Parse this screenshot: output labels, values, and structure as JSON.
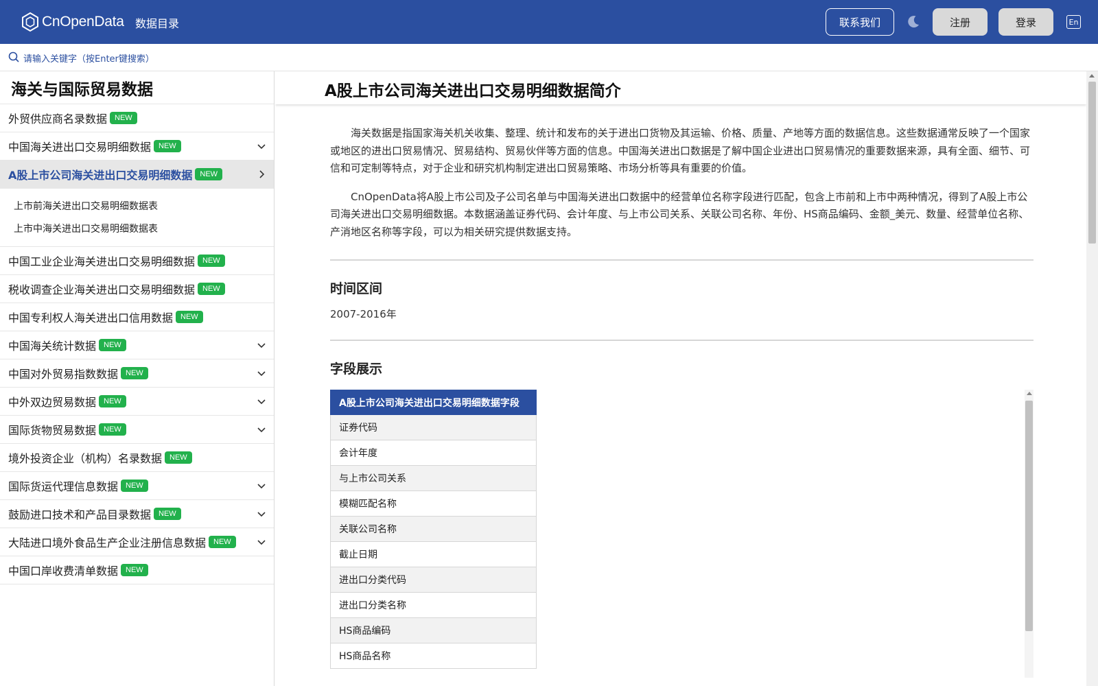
{
  "header": {
    "logo_text": "CnOpenData",
    "nav_catalog": "数据目录",
    "contact": "联系我们",
    "theme_icon": "moon-icon",
    "register": "注册",
    "login": "登录",
    "lang": "En",
    "brand_color": "#2b4fa0"
  },
  "search": {
    "placeholder": "请输入关键字（按Enter键搜索）"
  },
  "sidebar": {
    "title": "海关与国际贸易数据",
    "badge": "NEW",
    "badge_color": "#22b14c",
    "items": [
      {
        "label": "外贸供应商名录数据",
        "expandable": false
      },
      {
        "label": "中国海关进出口交易明细数据",
        "expandable": true
      },
      {
        "label": "A股上市公司海关进出口交易明细数据",
        "expandable": true,
        "active": true
      },
      {
        "label": "中国工业企业海关进出口交易明细数据",
        "expandable": false
      },
      {
        "label": "税收调查企业海关进出口交易明细数据",
        "expandable": false
      },
      {
        "label": "中国专利权人海关进出口信用数据",
        "expandable": false
      },
      {
        "label": "中国海关统计数据",
        "expandable": true
      },
      {
        "label": "中国对外贸易指数数据",
        "expandable": true
      },
      {
        "label": "中外双边贸易数据",
        "expandable": true
      },
      {
        "label": "国际货物贸易数据",
        "expandable": true
      },
      {
        "label": "境外投资企业（机构）名录数据",
        "expandable": false
      },
      {
        "label": "国际货运代理信息数据",
        "expandable": true
      },
      {
        "label": "鼓励进口技术和产品目录数据",
        "expandable": true
      },
      {
        "label": "大陆进口境外食品生产企业注册信息数据",
        "expandable": true
      },
      {
        "label": "中国口岸收费清单数据",
        "expandable": false
      }
    ],
    "subitems": [
      "上市前海关进出口交易明细数据表",
      "上市中海关进出口交易明细数据表"
    ]
  },
  "main": {
    "title": "A股上市公司海关进出口交易明细数据简介",
    "paragraphs": [
      "海关数据是指国家海关机关收集、整理、统计和发布的关于进出口货物及其运输、价格、质量、产地等方面的数据信息。这些数据通常反映了一个国家或地区的进出口贸易情况、贸易结构、贸易伙伴等方面的信息。中国海关进出口数据是了解中国企业进出口贸易情况的重要数据来源，具有全面、细节、可信和可定制等特点，对于企业和研究机构制定进出口贸易策略、市场分析等具有重要的价值。",
      "CnOpenData将A股上市公司及子公司名单与中国海关进出口数据中的经营单位名称字段进行匹配，包含上市前和上市中两种情况，得到了A股上市公司海关进出口交易明细数据。本数据涵盖证券代码、会计年度、与上市公司关系、关联公司名称、年份、HS商品编码、金额_美元、数量、经营单位名称、产消地区名称等字段，可以为相关研究提供数据支持。"
    ],
    "time_title": "时间区间",
    "time_value": "2007-2016年",
    "fields_title": "字段展示",
    "table_header": "A股上市公司海关进出口交易明细数据字段",
    "fields": [
      "证券代码",
      "会计年度",
      "与上市公司关系",
      "模糊匹配名称",
      "关联公司名称",
      "截止日期",
      "进出口分类代码",
      "进出口分类名称",
      "HS商品编码",
      "HS商品名称"
    ]
  }
}
